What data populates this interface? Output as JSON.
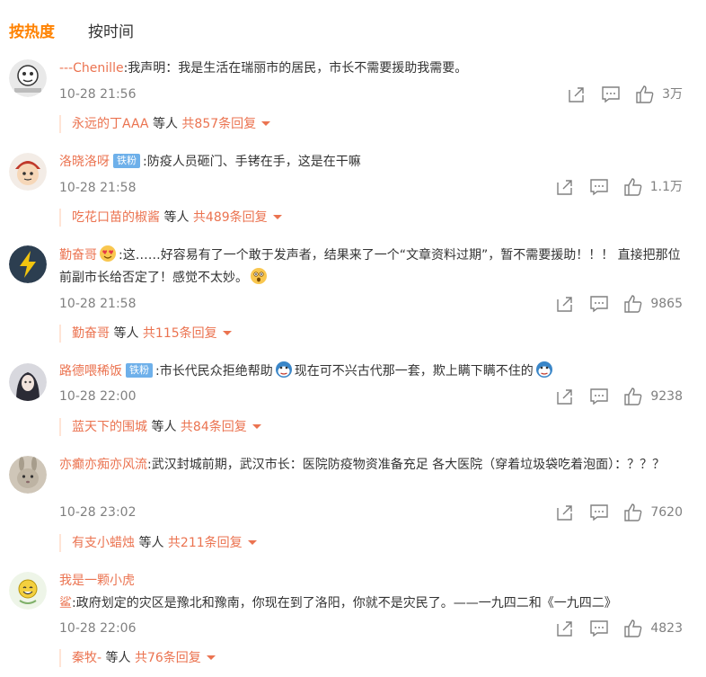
{
  "tabs": {
    "hot": "按热度",
    "time": "按时间"
  },
  "comments": [
    {
      "user": "---Chenille",
      "badge": "",
      "text": ":我声明：我是生活在瑞丽市的居民，市长不需要援助我需要。",
      "text2": "",
      "time": "10-28 21:56",
      "likes": "3万",
      "reply_user": "永远的丁AAA",
      "reply_mid": " 等人 ",
      "reply_count": "共857条回复"
    },
    {
      "user": "洛晓洛呀",
      "badge": "铁粉",
      "text": ":防疫人员砸门、手铐在手，这是在干嘛",
      "text2": "",
      "time": "10-28 21:58",
      "likes": "1.1万",
      "reply_user": "吃花口苗的椒酱",
      "reply_mid": " 等人 ",
      "reply_count": "共489条回复"
    },
    {
      "user": "勤奋哥",
      "badge": "",
      "text": ":这……好容易有了一个敢于发声者，结果来了一个“文章资料过期”，暂不需要援助！！！ 直接把那位前副市长给否定了！感觉不太妙。",
      "text2": "",
      "time": "10-28 21:58",
      "likes": "9865",
      "reply_user": "勤奋哥",
      "reply_mid": " 等人 ",
      "reply_count": "共115条回复"
    },
    {
      "user": "路德喂稀饭",
      "badge": "铁粉",
      "text": ":市长代民众拒绝帮助",
      "text2": "现在可不兴古代那一套，欺上瞒下瞒不住的",
      "time": "10-28 22:00",
      "likes": "9238",
      "reply_user": "蓝天下的围城",
      "reply_mid": " 等人 ",
      "reply_count": "共84条回复"
    },
    {
      "user": "亦癫亦痴亦风流",
      "badge": "",
      "text": ":武汉封城前期，武汉市长：医院防疫物资准备充足 各大医院（穿着垃圾袋吃着泡面）：？？？",
      "text2": "",
      "time": "10-28 23:02",
      "likes": "7620",
      "reply_user": "有支小蜡烛",
      "reply_mid": " 等人 ",
      "reply_count": "共211条回复"
    },
    {
      "user": "我是一颗小虎鲨",
      "badge": "",
      "text": ":政府划定的灾区是豫北和豫南，你现在到了洛阳，你就不是灾民了。——一九四二和《一九四二》",
      "text2": "",
      "time": "10-28 22:06",
      "likes": "4823",
      "reply_user": "秦牧-",
      "reply_mid": " 等人 ",
      "reply_count": "共76条回复"
    }
  ],
  "icons": {
    "share": "share-icon",
    "comment": "comment-icon",
    "like": "like-icon",
    "dropdown": "chevron-down-icon"
  },
  "colors": {
    "accent": "#ff8200",
    "username": "#eb7350",
    "badge": "#6eb0ea",
    "meta": "#808080"
  }
}
